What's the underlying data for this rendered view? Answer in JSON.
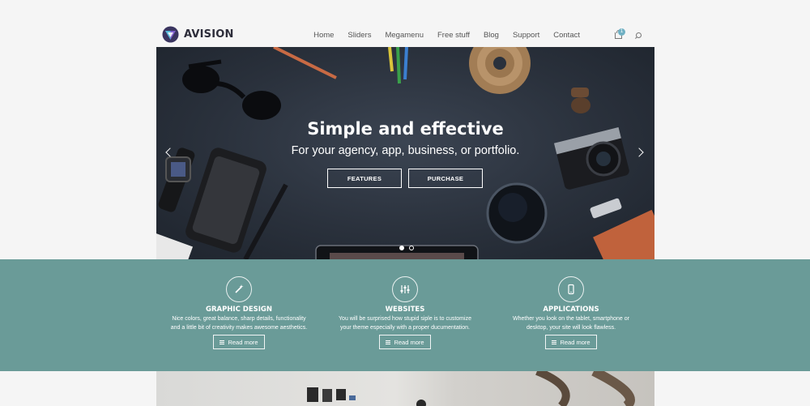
{
  "header": {
    "logo_text": "AVISION",
    "nav": [
      "Home",
      "Sliders",
      "Megamenu",
      "Free stuff",
      "Blog",
      "Support",
      "Contact"
    ],
    "cart_count": "1",
    "icons": {
      "cart": "shopping-bag-icon",
      "search": "search-icon"
    }
  },
  "hero": {
    "title": "Simple and effective",
    "subtitle": "For your agency, app, business, or portfolio.",
    "buttons": [
      "FEATURES",
      "PURCHASE"
    ],
    "slide_count": 2,
    "active_slide": 1
  },
  "features": [
    {
      "icon": "magic-wand-icon",
      "title": "GRAPHIC DESIGN",
      "desc_line1": "Nice colors, great balance, sharp details, functionality",
      "desc_line2": "and a little bit of creativity makes awesome aesthetics.",
      "button": "Read more"
    },
    {
      "icon": "sliders-icon",
      "title": "WEBSITES",
      "desc_line1": "You will be surprised how stupid siple is to customize",
      "desc_line2": "your theme especially with a proper ducumentation.",
      "button": "Read more"
    },
    {
      "icon": "mobile-phone-icon",
      "title": "APPLICATIONS",
      "desc_line1": "Whether you look on the tablet, smartphone or",
      "desc_line2": "desktop, your site will look flawless.",
      "button": "Read more"
    }
  ],
  "colors": {
    "accent_teal": "#6a9b98",
    "hero_bg": "#2a313c",
    "badge": "#6fb0c3"
  }
}
